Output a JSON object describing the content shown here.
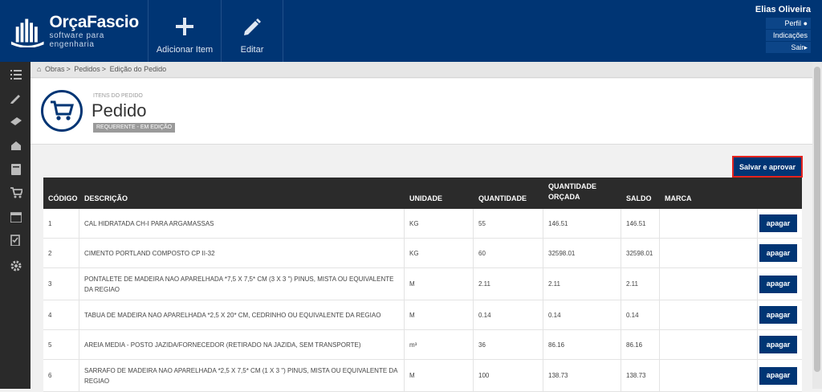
{
  "brand": {
    "name": "OrçaFascio",
    "tagline": "software para engenharia"
  },
  "toolbar": {
    "add_label": "Adicionar Item",
    "edit_label": "Editar"
  },
  "user": {
    "name": "Elias Oliveira",
    "links": [
      "Perfil",
      "Indicações",
      "Sair"
    ]
  },
  "breadcrumb": {
    "items": [
      "Obras",
      "Pedidos",
      "Edição do Pedido"
    ]
  },
  "page": {
    "kicker": "ITENS DO PEDIDO",
    "title": "Pedido",
    "status": "REQUERENTE - EM EDIÇÃO"
  },
  "actions": {
    "save_approve": "Salvar e aprovar"
  },
  "table": {
    "headers": {
      "codigo": "CÓDIGO",
      "descricao": "DESCRIÇÃO",
      "unidade": "UNIDADE",
      "quantidade": "QUANTIDADE",
      "qtd_orcada": "QUANTIDADE ORÇADA",
      "saldo": "SALDO",
      "marca": "MARCA"
    },
    "delete_label": "apagar",
    "rows": [
      {
        "codigo": "1",
        "descricao": "CAL HIDRATADA CH-I PARA ARGAMASSAS",
        "unidade": "KG",
        "quantidade": "55",
        "qtd_orcada": "146.51",
        "saldo": "146.51",
        "marca": ""
      },
      {
        "codigo": "2",
        "descricao": "CIMENTO PORTLAND COMPOSTO CP II-32",
        "unidade": "KG",
        "quantidade": "60",
        "qtd_orcada": "32598.01",
        "saldo": "32598.01",
        "marca": ""
      },
      {
        "codigo": "3",
        "descricao": "PONTALETE DE MADEIRA NAO APARELHADA *7,5 X 7,5* CM (3 X 3 \") PINUS, MISTA OU EQUIVALENTE DA REGIAO",
        "unidade": "M",
        "quantidade": "2.11",
        "qtd_orcada": "2.11",
        "saldo": "2.11",
        "marca": ""
      },
      {
        "codigo": "4",
        "descricao": "TABUA DE MADEIRA NAO APARELHADA *2,5 X 20* CM, CEDRINHO OU EQUIVALENTE DA REGIAO",
        "unidade": "M",
        "quantidade": "0.14",
        "qtd_orcada": "0.14",
        "saldo": "0.14",
        "marca": ""
      },
      {
        "codigo": "5",
        "descricao": "AREIA MEDIA - POSTO JAZIDA/FORNECEDOR (RETIRADO NA JAZIDA, SEM TRANSPORTE)",
        "unidade": "m³",
        "quantidade": "36",
        "qtd_orcada": "86.16",
        "saldo": "86.16",
        "marca": ""
      },
      {
        "codigo": "6",
        "descricao": "SARRAFO DE MADEIRA NAO APARELHADA *2,5 X 7,5* CM (1 X 3 \") PINUS, MISTA OU EQUIVALENTE DA REGIAO",
        "unidade": "M",
        "quantidade": "100",
        "qtd_orcada": "138.73",
        "saldo": "138.73",
        "marca": ""
      }
    ]
  }
}
